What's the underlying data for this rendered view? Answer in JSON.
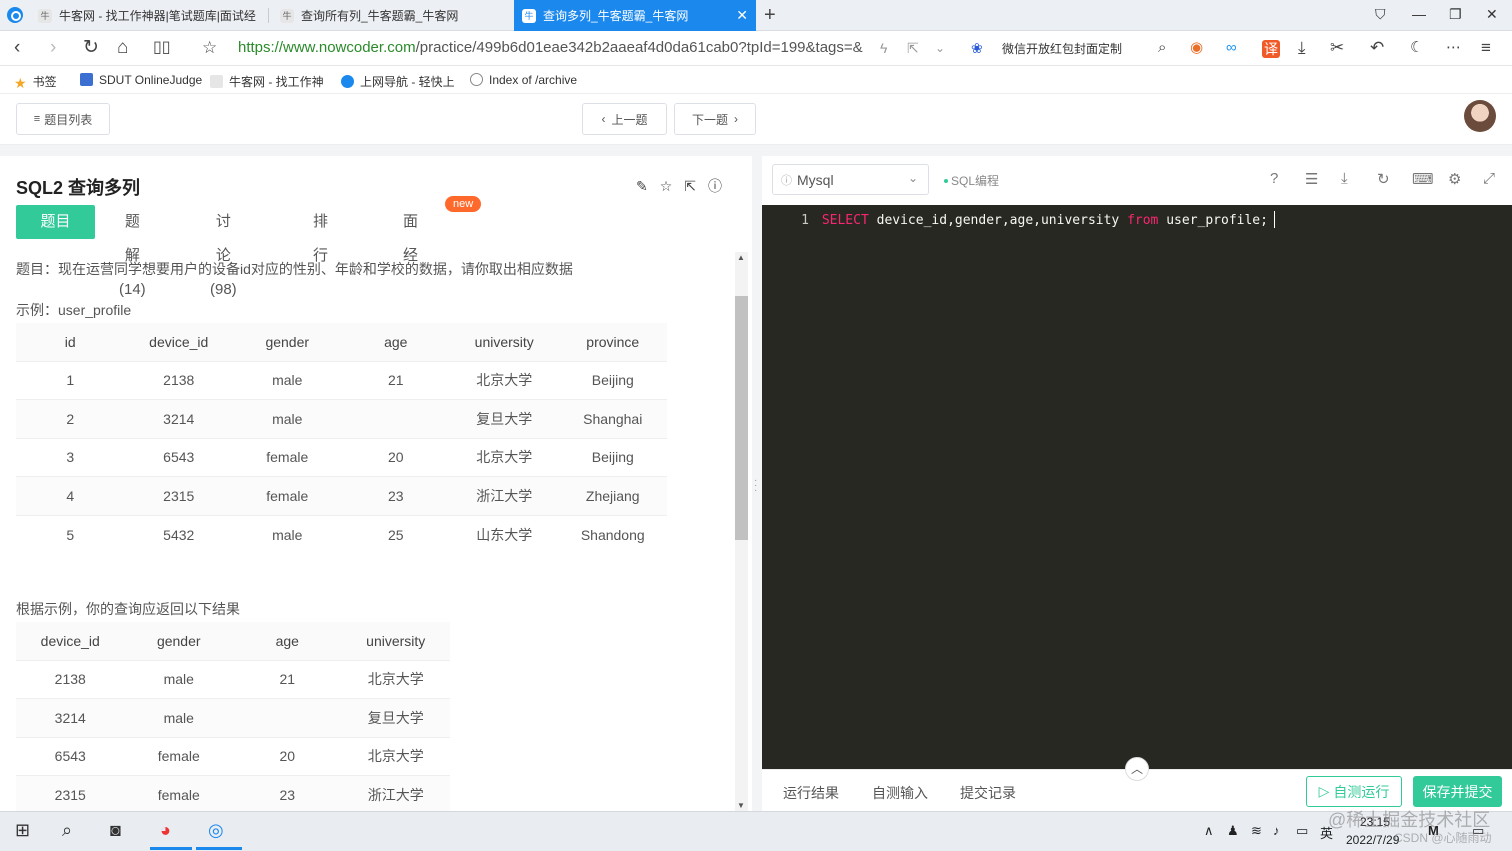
{
  "browser": {
    "tabs": [
      {
        "label": "牛客网 - 找工作神器|笔试题库|面试经"
      },
      {
        "label": "查询所有列_牛客题霸_牛客网"
      },
      {
        "label": "查询多列_牛客题霸_牛客网"
      }
    ],
    "url_host": "https://www.nowcoder.com",
    "url_path": "/practice/499b6d01eae342b2aaeaf4d0da61cab0?tpId=199&tags=&",
    "extension_text": "微信开放红包封面定制",
    "bookmarks": [
      "书签",
      "SDUT OnlineJudge",
      "牛客网 - 找工作神",
      "上网导航 - 轻快上",
      "Index of /archive"
    ]
  },
  "header": {
    "problem_list": "题目列表",
    "prev": "上一题",
    "next": "下一题"
  },
  "problem": {
    "title": "SQL2  查询多列",
    "tabs": [
      "题目",
      "题解(14)",
      "讨论(98)",
      "排行",
      "面经"
    ],
    "new_badge": "new",
    "description": "题目：现在运营同学想要用户的设备id对应的性别、年龄和学校的数据，请你取出相应数据",
    "example_label": "示例：user_profile",
    "example_table": {
      "columns": [
        "id",
        "device_id",
        "gender",
        "age",
        "university",
        "province"
      ],
      "rows": [
        [
          "1",
          "2138",
          "male",
          "21",
          "北京大学",
          "Beijing"
        ],
        [
          "2",
          "3214",
          "male",
          "",
          "复旦大学",
          "Shanghai"
        ],
        [
          "3",
          "6543",
          "female",
          "20",
          "北京大学",
          "Beijing"
        ],
        [
          "4",
          "2315",
          "female",
          "23",
          "浙江大学",
          "Zhejiang"
        ],
        [
          "5",
          "5432",
          "male",
          "25",
          "山东大学",
          "Shandong"
        ]
      ]
    },
    "result_label": "根据示例，你的查询应返回以下结果",
    "result_table": {
      "columns": [
        "device_id",
        "gender",
        "age",
        "university"
      ],
      "rows": [
        [
          "2138",
          "male",
          "21",
          "北京大学"
        ],
        [
          "3214",
          "male",
          "",
          "复旦大学"
        ],
        [
          "6543",
          "female",
          "20",
          "北京大学"
        ],
        [
          "2315",
          "female",
          "23",
          "浙江大学"
        ]
      ]
    }
  },
  "editor": {
    "language": "Mysql",
    "tag": "SQL编程",
    "line_number": "1",
    "code_kw1": "SELECT",
    "code_mid": " device_id,gender,age,university ",
    "code_kw2": "from",
    "code_end": " user_profile;",
    "bottom_tabs": [
      "运行结果",
      "自测输入",
      "提交记录"
    ],
    "run_label": "自测运行",
    "submit_label": "保存并提交"
  },
  "taskbar": {
    "time": "23:15",
    "date": "2022/7/29",
    "ime": "英",
    "watermark": "@稀土掘金技术社区",
    "watermark2": "CSDN @心随雨动"
  },
  "colors": {
    "accent": "#32ca99",
    "browser_blue": "#1b88ee",
    "editor_bg": "#272822",
    "keyword": "#f92672",
    "badge": "#ff6a2c"
  }
}
